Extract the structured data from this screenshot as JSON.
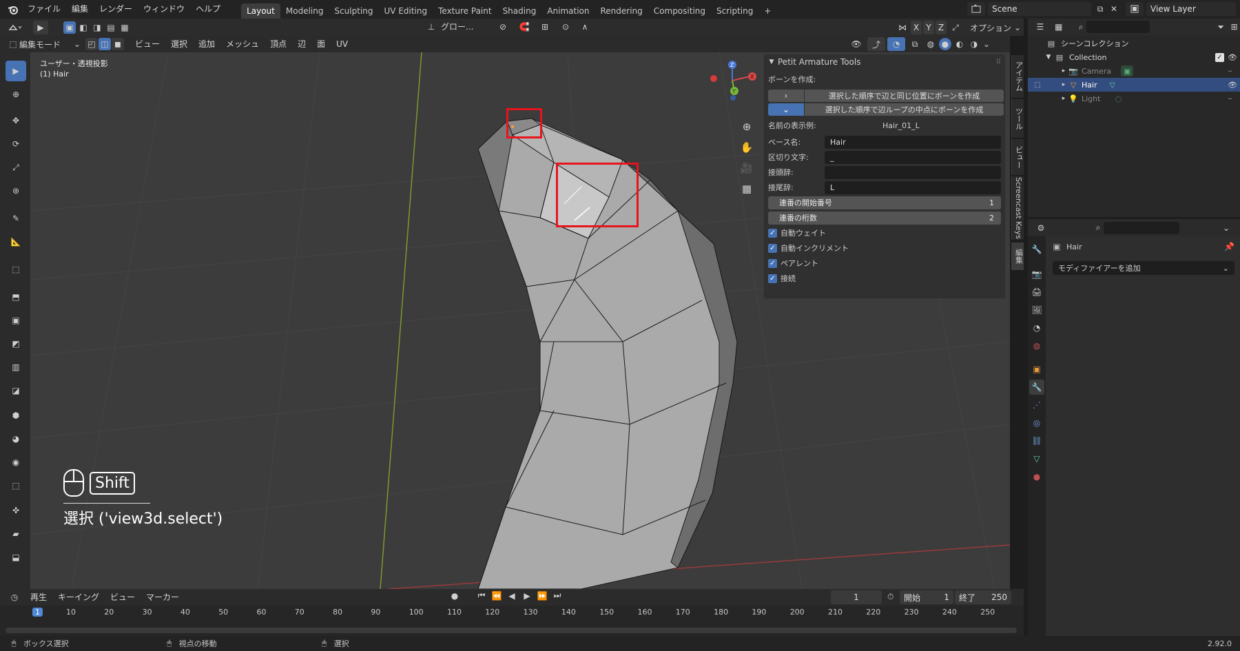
{
  "topbar": {
    "menus": [
      "ファイル",
      "編集",
      "レンダー",
      "ウィンドウ",
      "ヘルプ"
    ],
    "workspaces": [
      "Layout",
      "Modeling",
      "Sculpting",
      "UV Editing",
      "Texture Paint",
      "Shading",
      "Animation",
      "Rendering",
      "Compositing",
      "Scripting"
    ],
    "active_workspace": "Layout",
    "add_tab": "+",
    "scene": "Scene",
    "view_layer": "View Layer"
  },
  "viewport_header": {
    "transform_orientation": "グロー...",
    "axes": [
      "X",
      "Y",
      "Z"
    ],
    "options": "オプション",
    "mode": "編集モード",
    "menus": [
      "ビュー",
      "選択",
      "追加",
      "メッシュ",
      "頂点",
      "辺",
      "面",
      "UV"
    ]
  },
  "viewport": {
    "view_name": "ユーザー・透視投影",
    "object_name": "(1) Hair",
    "gizmo_axes": {
      "x": "X",
      "y": "Y",
      "z": "Z"
    },
    "screencast_key": "Shift",
    "screencast_operator": "選択 ('view3d.select')"
  },
  "npanel": {
    "title": "Petit Armature Tools",
    "section": "ボーンを作成:",
    "button_1": "選択した順序で辺と同じ位置にボーンを作成",
    "button_2": "選択した順序で辺ループの中点にボーンを作成",
    "example_label": "名前の表示例:",
    "example_value": "Hair_01_L",
    "base_label": "ベース名:",
    "base_value": "Hair",
    "sep_label": "区切り文字:",
    "sep_value": "_",
    "prefix_label": "接頭辞:",
    "prefix_value": "",
    "suffix_label": "接尾辞:",
    "suffix_value": "L",
    "start_label": "連番の開始番号",
    "start_value": "1",
    "digits_label": "連番の桁数",
    "digits_value": "2",
    "checks": [
      "自動ウェイト",
      "自動インクリメント",
      "ペアレント",
      "接続"
    ],
    "checkmark": "✓"
  },
  "side_tabs": [
    "アイテム",
    "ツール",
    "ビュー",
    "Screencast Keys",
    "編集"
  ],
  "outliner": {
    "root": "シーンコレクション",
    "collection": "Collection",
    "items": [
      "Camera",
      "Hair",
      "Light"
    ],
    "selected": "Hair"
  },
  "properties": {
    "object": "Hair",
    "add_modifier": "モディファイアーを追加"
  },
  "timeline": {
    "menus": [
      "再生",
      "キーイング",
      "ビュー",
      "マーカー"
    ],
    "current_frame": "1",
    "start_label": "開始",
    "start_value": "1",
    "end_label": "終了",
    "end_value": "250",
    "ruler": [
      "1",
      "10",
      "20",
      "30",
      "40",
      "50",
      "60",
      "70",
      "80",
      "90",
      "100",
      "110",
      "120",
      "130",
      "140",
      "150",
      "160",
      "170",
      "180",
      "190",
      "200",
      "210",
      "220",
      "230",
      "240",
      "250"
    ]
  },
  "statusbar": {
    "items": [
      "ボックス選択",
      "視点の移動",
      "選択"
    ],
    "version": "2.92.0"
  },
  "colors": {
    "accent": "#4772b3",
    "highlight_box": "#e8141c",
    "active_frame": "#4f89d6"
  }
}
